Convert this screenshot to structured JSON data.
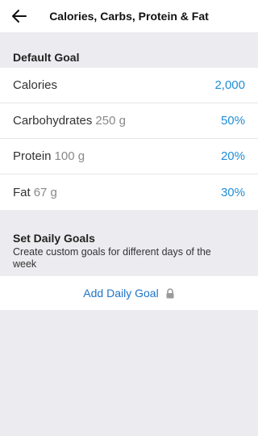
{
  "header": {
    "title": "Calories, Carbs, Protein & Fat",
    "back_icon": "arrow-left-icon"
  },
  "default_goal": {
    "title": "Default Goal",
    "rows": [
      {
        "label": "Calories",
        "sub": "",
        "value": "2,000"
      },
      {
        "label": "Carbohydrates",
        "sub": "250 g",
        "value": "50%"
      },
      {
        "label": "Protein",
        "sub": "100 g",
        "value": "20%"
      },
      {
        "label": "Fat",
        "sub": "67 g",
        "value": "30%"
      }
    ]
  },
  "daily_goals": {
    "title": "Set Daily Goals",
    "description": "Create custom goals for different days of the week",
    "add_label": "Add Daily Goal",
    "lock_icon": "lock-icon"
  },
  "colors": {
    "accent": "#1f8ed6",
    "link": "#1f74c8",
    "background": "#ececf0"
  }
}
